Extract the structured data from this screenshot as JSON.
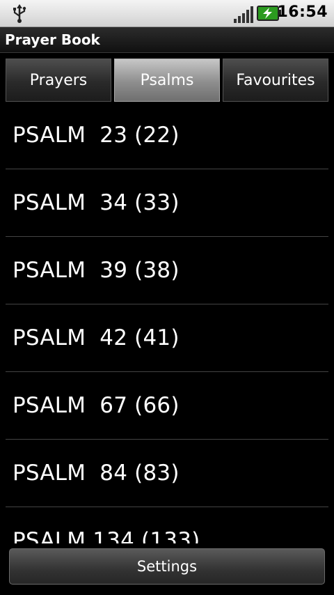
{
  "status_bar": {
    "time": "16:54",
    "icons": [
      "usb-icon",
      "signal-icon",
      "battery-charging-icon"
    ]
  },
  "app": {
    "title": "Prayer Book"
  },
  "tabs": [
    {
      "label": "Prayers",
      "selected": false
    },
    {
      "label": "Psalms",
      "selected": true
    },
    {
      "label": "Favourites",
      "selected": false
    }
  ],
  "psalms": [
    "PSALM  23 (22)",
    "PSALM  34 (33)",
    "PSALM  39 (38)",
    "PSALM  42 (41)",
    "PSALM  67 (66)",
    "PSALM  84 (83)",
    "PSALM 134 (133)"
  ],
  "footer": {
    "settings_label": "Settings"
  },
  "colors": {
    "background": "#000000",
    "selected_tab": "#9a9a9a",
    "divider": "#444444"
  }
}
